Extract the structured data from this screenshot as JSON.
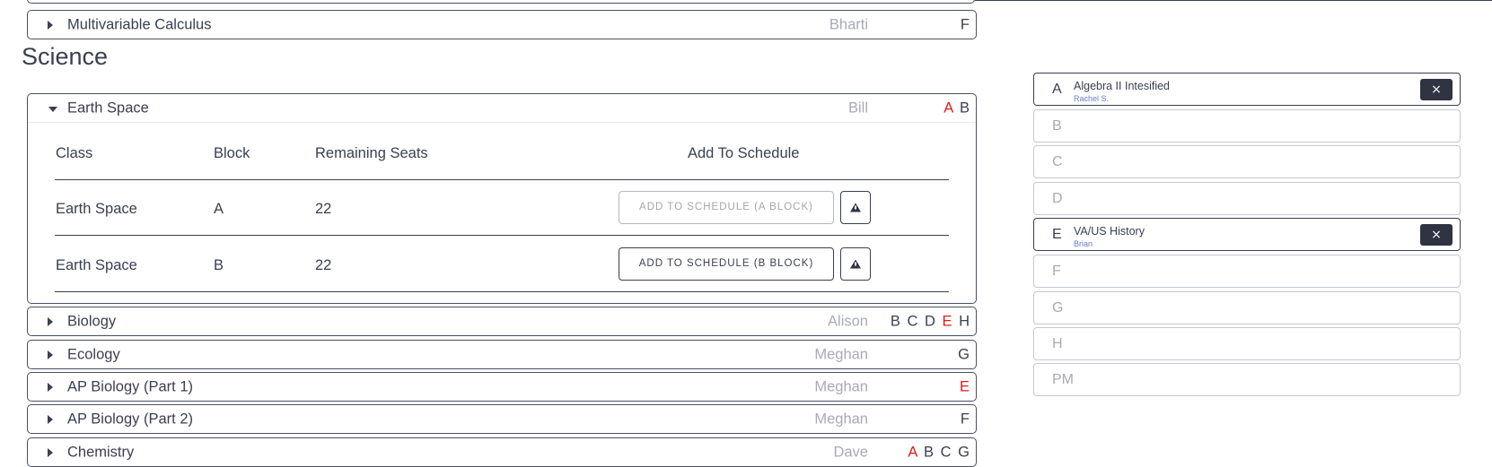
{
  "math_partial": {
    "name": "Multivariable Calculus",
    "teacher": "Bharti",
    "blocks": [
      {
        "letter": "F",
        "conflict": false
      }
    ]
  },
  "science": {
    "title": "Science",
    "expanded": {
      "name": "Earth Space",
      "teacher": "Bill",
      "blocks": [
        {
          "letter": "A",
          "conflict": true
        },
        {
          "letter": "B",
          "conflict": false
        }
      ],
      "table": {
        "headers": [
          "Class",
          "Block",
          "Remaining Seats",
          "Add To Schedule"
        ],
        "rows": [
          {
            "class": "Earth Space",
            "block": "A",
            "seats": "22",
            "button": "ADD TO SCHEDULE (A BLOCK)",
            "disabled": true
          },
          {
            "class": "Earth Space",
            "block": "B",
            "seats": "22",
            "button": "ADD TO SCHEDULE (B BLOCK)",
            "disabled": false
          }
        ]
      }
    },
    "courses": [
      {
        "name": "Biology",
        "teacher": "Alison",
        "blocks": [
          {
            "letter": "B",
            "conflict": false
          },
          {
            "letter": "C",
            "conflict": false
          },
          {
            "letter": "D",
            "conflict": false
          },
          {
            "letter": "E",
            "conflict": true
          },
          {
            "letter": "H",
            "conflict": false
          }
        ]
      },
      {
        "name": "Ecology",
        "teacher": "Meghan",
        "blocks": [
          {
            "letter": "G",
            "conflict": false
          }
        ]
      },
      {
        "name": "AP Biology (Part 1)",
        "teacher": "Meghan",
        "blocks": [
          {
            "letter": "E",
            "conflict": true
          }
        ]
      },
      {
        "name": "AP Biology (Part 2)",
        "teacher": "Meghan",
        "blocks": [
          {
            "letter": "F",
            "conflict": false
          }
        ]
      },
      {
        "name": "Chemistry",
        "teacher": "Dave",
        "blocks": [
          {
            "letter": "A",
            "conflict": true
          },
          {
            "letter": "B",
            "conflict": false
          },
          {
            "letter": "C",
            "conflict": false
          },
          {
            "letter": "G",
            "conflict": false
          }
        ]
      }
    ]
  },
  "schedule": {
    "slots": [
      {
        "letter": "A",
        "class": "Algebra II Intesified",
        "teacher": "Rachel S.",
        "filled": true,
        "remove_label": "×"
      },
      {
        "letter": "B",
        "filled": false
      },
      {
        "letter": "C",
        "filled": false
      },
      {
        "letter": "D",
        "filled": false
      },
      {
        "letter": "E",
        "class": "VA/US History",
        "teacher": "Brian",
        "filled": true,
        "remove_label": "×"
      },
      {
        "letter": "F",
        "filled": false
      },
      {
        "letter": "G",
        "filled": false
      },
      {
        "letter": "H",
        "filled": false
      },
      {
        "letter": "PM",
        "filled": false
      }
    ]
  }
}
